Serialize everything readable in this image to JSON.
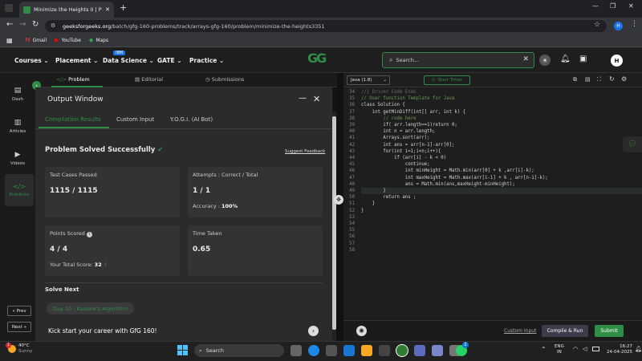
{
  "browser": {
    "tab_title": "Minimize the Heights II | Practic",
    "url_domain": "geeksforgeeks.org",
    "url_path": "/batch/gfg-160-problems/track/arrays-gfg-160/problem/minimize-the-heights3351",
    "profile_initial": "H",
    "bookmarks": [
      "Gmail",
      "YouTube",
      "Maps"
    ]
  },
  "nav": {
    "items": [
      "Courses",
      "Placement",
      "Data Science",
      "GATE",
      "Practice"
    ],
    "badge": "IBM",
    "logo": "GG",
    "search_placeholder": "Search...",
    "profile_initial": "H"
  },
  "rail": {
    "items": [
      "Dash",
      "Articles",
      "Videos",
      "Problems"
    ],
    "prev": "Prev",
    "next": "Next"
  },
  "left_tabs": [
    "Problem",
    "Editorial",
    "Submissions"
  ],
  "output": {
    "title": "Output Window",
    "tabs": [
      "Compilation Results",
      "Custom Input",
      "Y.O.G.I. (AI Bot)"
    ],
    "status": "Problem Solved Successfully",
    "feedback": "Suggest Feedback",
    "tests_label": "Test Cases Passed",
    "tests_value": "1115 / 1115",
    "attempts_label": "Attempts : Correct / Total",
    "attempts_value": "1 / 1",
    "accuracy_label": "Accuracy :",
    "accuracy_value": "100%",
    "points_label": "Points Scored",
    "points_value": "4 / 4",
    "score_label": "Your Total Score:",
    "score_value": "32",
    "time_label": "Time Taken",
    "time_value": "0.65",
    "solve_next": "Solve Next",
    "next_problem": "Day 10 - Kadane's Algorithm",
    "kickstart": "Kick start your career with GfG 160!"
  },
  "editor": {
    "language": "Java (1.8)",
    "timer": "Start Timer",
    "lines": [
      {
        "n": "34",
        "t": "//} Driver Code Ends"
      },
      {
        "n": "35",
        "t": ""
      },
      {
        "n": "36",
        "t": ""
      },
      {
        "n": "37",
        "t": "// User function Template for Java"
      },
      {
        "n": "38",
        "t": ""
      },
      {
        "n": "39",
        "t": "class Solution {"
      },
      {
        "n": "40",
        "t": "    int getMinDiff(int[] arr, int k) {"
      },
      {
        "n": "41",
        "t": "        // code here"
      },
      {
        "n": "42",
        "t": "        if( arr.length==1)return 0;"
      },
      {
        "n": "43",
        "t": "        int n = arr.length;"
      },
      {
        "n": "44",
        "t": ""
      },
      {
        "n": "45",
        "t": "        Arrays.sort(arr);"
      },
      {
        "n": "46",
        "t": "        int ans = arr[n-1]-arr[0];"
      },
      {
        "n": "47",
        "t": "        for(int i=1;i<n;i++){"
      },
      {
        "n": "48",
        "t": "            if (arr[i] - k < 0)"
      },
      {
        "n": "49",
        "t": "                continue;"
      },
      {
        "n": "50",
        "t": "                int minHeight = Math.min(arr[0] + k ,arr[i]-k);"
      },
      {
        "n": "51",
        "t": "                int maxHeight = Math.max(arr[i-1] + k , arr[n-1]-k);"
      },
      {
        "n": "52",
        "t": "                ans = Math.min(ans,maxHeight-minHeight);"
      },
      {
        "n": "53",
        "t": "        }"
      },
      {
        "n": "54",
        "t": "        return ans ;"
      },
      {
        "n": "55",
        "t": ""
      },
      {
        "n": "56",
        "t": "    }"
      },
      {
        "n": "57",
        "t": "}"
      },
      {
        "n": "58",
        "t": ""
      }
    ],
    "custom_input": "Custom Input",
    "compile": "Compile & Run",
    "submit": "Submit"
  },
  "taskbar": {
    "temp": "40°C",
    "weather": "Sunny",
    "search": "Search",
    "lang1": "ENG",
    "lang2": "IN",
    "time": "16:27",
    "date": "24-04-2025",
    "weather_badge": "1",
    "chat_badge": "2"
  },
  "colors": {
    "accent": "#2f8d46",
    "dark": "#1e1e1e",
    "panel": "#2b2b2b"
  }
}
